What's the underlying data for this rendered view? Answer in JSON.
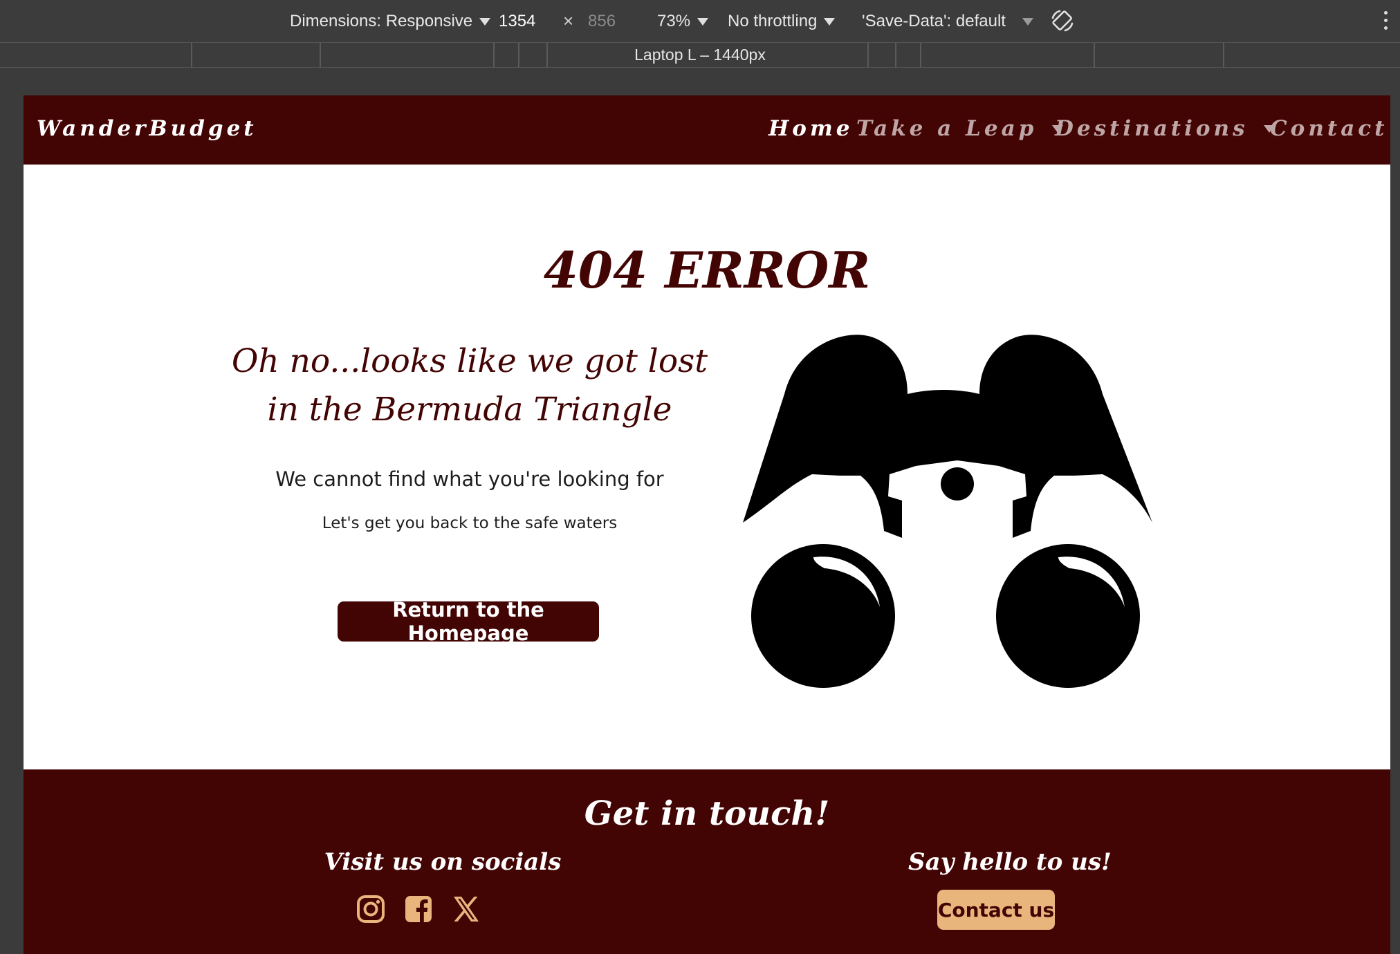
{
  "devtools": {
    "dimensions_label": "Dimensions: Responsive",
    "width_value": "1354",
    "times_symbol": "×",
    "height_value": "856",
    "zoom_label": "73%",
    "throttling_label": "No throttling",
    "save_data_label": "'Save-Data': default",
    "device_ruler_label": "Laptop L – 1440px",
    "rotate_icon": "rotate-icon",
    "more_icon": "more-vertical-icon"
  },
  "navbar": {
    "brand": "WanderBudget",
    "links": [
      {
        "label": "Home",
        "active": true
      },
      {
        "label": "Take a Leap",
        "dropdown": true
      },
      {
        "label": "Destinations",
        "dropdown": true
      },
      {
        "label": "Contact"
      }
    ]
  },
  "main": {
    "title": "404 ERROR",
    "message_line1": "Oh no...looks like we got lost",
    "message_line2": "in the Bermuda Triangle",
    "subtitle": "We cannot find what you're looking for",
    "subtitle2": "Let's get you back to the safe waters",
    "home_button": "Return to the Homepage",
    "illustration_icon": "binoculars-icon"
  },
  "footer": {
    "heading": "Get in touch!",
    "socials_heading": "Visit us on socials",
    "social_icons": [
      "instagram-icon",
      "facebook-icon",
      "x-twitter-icon"
    ],
    "hello_heading": "Say hello to us!",
    "contact_button": "Contact us"
  },
  "colors": {
    "brand_dark_red": "#430404",
    "accent_tan": "#e8b57d",
    "devtools_bg": "#3c3c3c"
  }
}
